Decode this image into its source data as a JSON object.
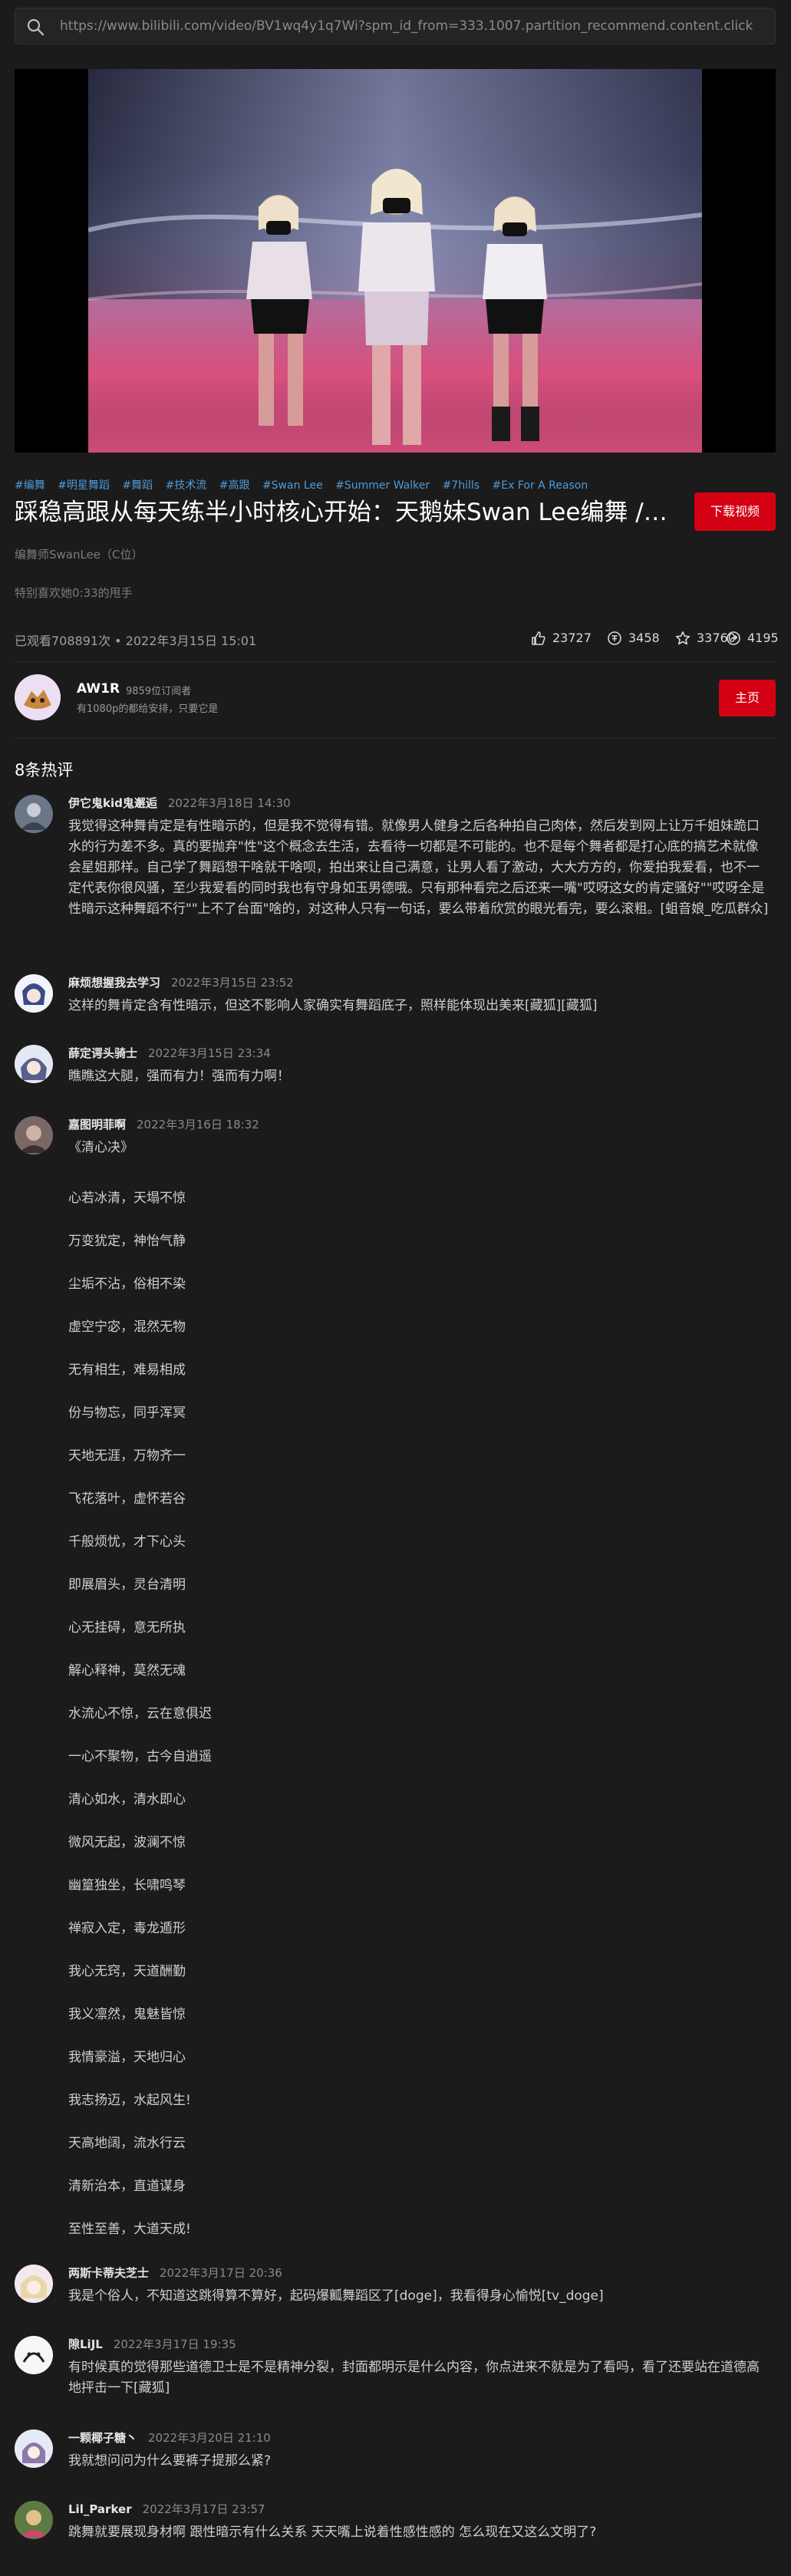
{
  "address_bar": {
    "url": "https://www.bilibili.com/video/BV1wq4y1q7Wi?spm_id_from=333.1007.partition_recommend.content.click"
  },
  "video": {
    "tags": [
      "#编舞",
      "#明星舞蹈",
      "#舞蹈",
      "#技术流",
      "#高跟",
      "#Swan Lee",
      "#Summer Walker",
      "#7hills",
      "#Ex For A Reason"
    ],
    "title": "踩稳高跟从每天练半小时核心开始：天鹅妹Swan Lee编舞 / Summer Walker - Ex For A Reason",
    "download_label": "下载视频",
    "choreographer": "编舞师SwanLee（C位）",
    "note": "特别喜欢她0:33的甩手",
    "views": "已观看708891次 • 2022年3月15日 15:01",
    "likes": "23727",
    "coins": "3458",
    "favorites": "33760",
    "shares": "4195"
  },
  "uploader": {
    "name": "AW1R",
    "subscribers": "9859位订阅者",
    "description": "有1080p的都给安排，只要它是",
    "homepage_label": "主页"
  },
  "comments_title": "8条热评",
  "comments": [
    {
      "user": "伊它鬼kid鬼邂逅",
      "time": "2022年3月18日 14:30",
      "text": "我觉得这种舞肯定是有性暗示的，但是我不觉得有错。就像男人健身之后各种拍自己肉体，然后发到网上让万千姐妹跪口水的行为差不多。真的要抛弃\"性\"这个概念去生活，去看待一切都是不可能的。也不是每个舞者都是打心底的搞艺术就像会星姐那样。自己学了舞蹈想干啥就干啥呗，拍出来让自己满意，让男人看了激动，大大方方的，你爱拍我爱看，也不一定代表你很风骚，至少我爱看的同时我也有守身如玉男德哦。只有那种看完之后还来一嘴\"哎呀这女的肯定骚好\"\"哎呀全是性暗示这种舞蹈不行\"\"上不了台面\"啥的，对这种人只有一句话，要么带着欣赏的眼光看完，要么滚粗。[蛆音娘_吃瓜群众]"
    },
    {
      "user": "麻烦想握我去学习",
      "time": "2022年3月15日 23:52",
      "text": "这样的舞肯定含有性暗示，但这不影响人家确实有舞蹈底子，照样能体现出美来[藏狐][藏狐]"
    },
    {
      "user": "薛定谔头骑士",
      "time": "2022年3月15日 23:34",
      "text": "瞧瞧这大腿，强而有力！强而有力啊！"
    },
    {
      "user": "嘉图明菲啊",
      "time": "2022年3月16日 18:32",
      "text": "《清心决》"
    },
    {
      "user": "两斯卡蒂夫芝士",
      "time": "2022年3月17日 20:36",
      "text": "我是个俗人，不知道这跳得算不算好，起码爆瓤舞蹈区了[doge]，我看得身心愉悦[tv_doge]"
    },
    {
      "user": "隙LiJL",
      "time": "2022年3月17日 19:35",
      "text": "有时候真的觉得那些道德卫士是不是精神分裂，封面都明示是什么内容，你点进来不就是为了看吗，看了还要站在道德高地抨击一下[藏狐]"
    },
    {
      "user": "一颗椰子糖丶",
      "time": "2022年3月20日 21:10",
      "text": "我就想问问为什么要裤子提那么紧?"
    },
    {
      "user": "Lil_Parker",
      "time": "2022年3月17日 23:57",
      "text": "跳舞就要展现身材啊  跟性暗示有什么关系  天天嘴上说着性感性感的  怎么现在又这么文明了?"
    }
  ],
  "poem_lines": [
    "心若冰清，天塌不惊",
    "万变犹定，神怡气静",
    "尘垢不沾，俗相不染",
    "虚空宁宓，混然无物",
    "无有相生，难易相成",
    "份与物忘，同乎浑冥",
    "天地无涯，万物齐一",
    "飞花落叶，虚怀若谷",
    "千般烦忧，才下心头",
    "即展眉头，灵台清明",
    "心无挂碍，意无所执",
    "解心释神，莫然无魂",
    "水流心不惊，云在意俱迟",
    "一心不聚物，古今自逍遥",
    "清心如水，清水即心",
    "微风无起，波澜不惊",
    "幽篁独坐，长啸鸣琴",
    "禅寂入定，毒龙遁形",
    "我心无窍，天道酬勤",
    "我义凛然，鬼魅皆惊",
    "我情豪溢，天地归心",
    "我志扬迈，水起风生!",
    "天高地阔，流水行云",
    "清新治本，直道谋身",
    "至性至善，大道天成!"
  ]
}
